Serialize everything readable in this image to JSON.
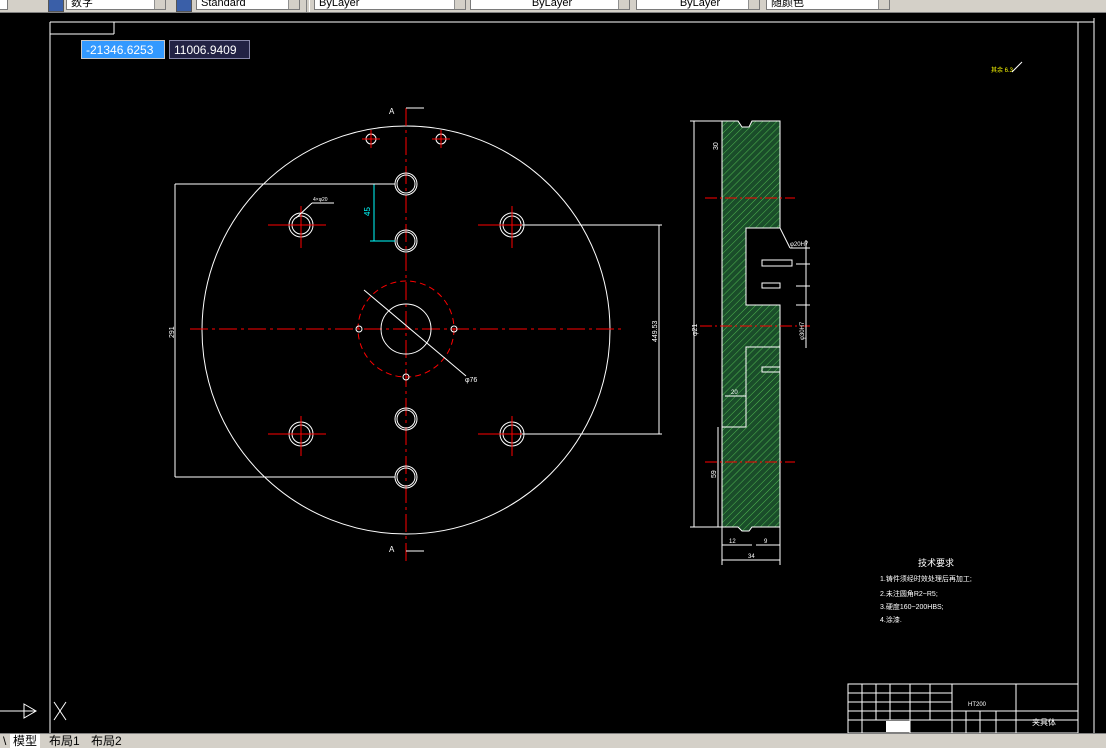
{
  "toolbar": {
    "text_style": "数字",
    "dim_style": "Standard",
    "layer_color": "ByLayer",
    "linetype": "ByLayer",
    "lineweight": "ByLayer",
    "plot_style": "随颜色"
  },
  "coords": {
    "x": "-21346.6253",
    "y": "11006.9409"
  },
  "drawing": {
    "section_label_top": "A",
    "section_label_bottom": "A",
    "roughness_note": "其余 6.3",
    "dim_hole_note": "4×φ20",
    "dim_45": "45",
    "dim_291": "291",
    "dim_449": "449.53",
    "dim_d76": "φ76",
    "side_dim_d21": "φ21",
    "side_dim_30": "30",
    "side_dim_34": "34",
    "side_dim_20": "20",
    "side_dim_9": "9",
    "side_dim_59": "59",
    "side_dim_12": "12",
    "side_dim_note1": "φ20H7",
    "side_dim_note2": "φ30H7",
    "tech_title": "技术要求",
    "tech_items": [
      "1.铸件须经时效处理后再加工;",
      "2.未注圆角R2~R5;",
      "3.硬度160~200HBS;",
      "4.涂漆."
    ],
    "title_material": "HT200",
    "title_name": "夹具体"
  },
  "tabs": {
    "model": "模型",
    "layout1": "布局1",
    "layout2": "布局2"
  }
}
